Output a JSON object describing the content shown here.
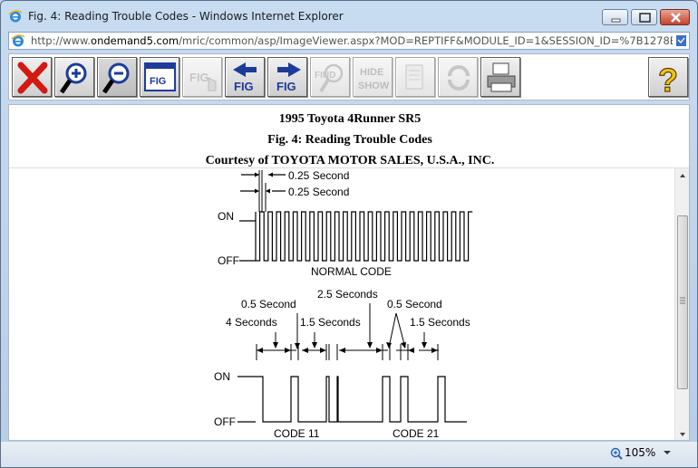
{
  "window": {
    "title": "Fig. 4: Reading Trouble Codes - Windows Internet Explorer"
  },
  "address": {
    "prefix": "http://www.",
    "domain": "ondemand5.com",
    "path": "/mric/common/asp/ImageViewer.aspx?MOD=REPTIFF&MODULE_ID=1&SESSION_ID=%7B1278E2BD-76A"
  },
  "toolbar": {
    "buttons": [
      {
        "name": "close-image",
        "icon": "red-x-icon",
        "enabled": true
      },
      {
        "name": "zoom-in",
        "icon": "magnifier-plus-icon",
        "enabled": true
      },
      {
        "name": "zoom-out",
        "icon": "magnifier-minus-icon",
        "enabled": true
      },
      {
        "name": "fit-figure",
        "icon": "fig-window-icon",
        "label": "FIG",
        "enabled": true
      },
      {
        "name": "pan-figure",
        "icon": "fig-hand-icon",
        "label": "FIG",
        "enabled": false
      },
      {
        "name": "previous-figure",
        "icon": "fig-left-arrow-icon",
        "label": "FIG",
        "enabled": true
      },
      {
        "name": "next-figure",
        "icon": "fig-right-arrow-icon",
        "label": "FIG",
        "enabled": true
      },
      {
        "name": "find",
        "icon": "find-magnifier-icon",
        "label": "FIND",
        "enabled": false
      },
      {
        "name": "hide-show",
        "icon": "hide-show-icon",
        "label": "HIDE SHOW",
        "label_top": "HIDE",
        "label_bottom": "SHOW",
        "enabled": false
      },
      {
        "name": "bookmark",
        "icon": "document-icon",
        "enabled": false
      },
      {
        "name": "rotate",
        "icon": "rotate-arrows-icon",
        "enabled": false
      },
      {
        "name": "print",
        "icon": "printer-icon",
        "enabled": true
      },
      {
        "name": "help",
        "icon": "question-mark-icon",
        "label": "?",
        "enabled": true
      }
    ]
  },
  "document": {
    "vehicle": "1995 Toyota 4Runner SR5",
    "figure_title": "Fig. 4: Reading Trouble Codes",
    "courtesy": "Courtesy of TOYOTA MOTOR SALES, U.S.A., INC."
  },
  "diagram": {
    "normal": {
      "label_top_timing": "0.25 Second",
      "label_second_timing": "0.25 Second",
      "on_label": "ON",
      "off_label": "OFF",
      "caption": "NORMAL CODE",
      "pulse_count": 26
    },
    "codes": {
      "on_label": "ON",
      "off_label": "OFF",
      "t_4s": "4 Seconds",
      "t_05s_a": "0.5 Second",
      "t_15s_a": "1.5 Seconds",
      "t_25s": "2.5 Seconds",
      "t_05s_b": "0.5 Second",
      "t_15s_b": "1.5 Seconds",
      "code11": "CODE 11",
      "code21": "CODE 21"
    }
  },
  "status": {
    "zoom": "105%"
  },
  "colors": {
    "close_red": "#d21a12",
    "icon_blue": "#1d3c99",
    "help_yellow": "#f2c418"
  }
}
